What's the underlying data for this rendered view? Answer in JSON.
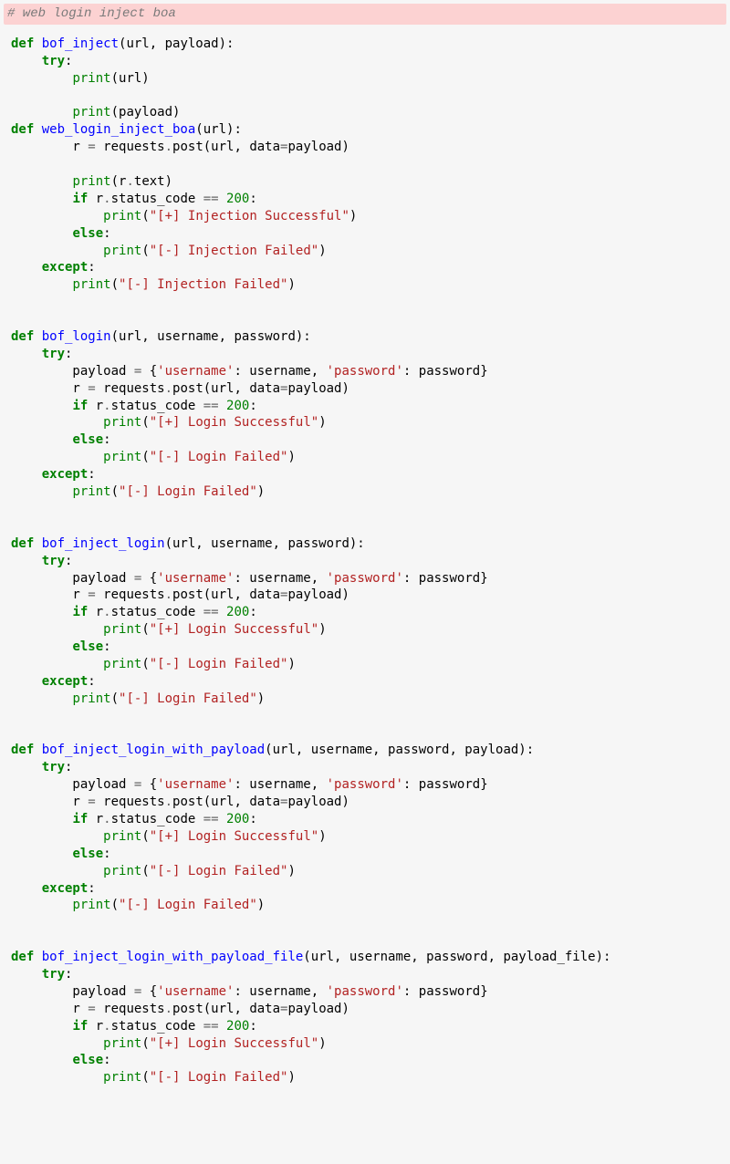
{
  "language": "python",
  "top_comment": "# web login inject boa",
  "code_lines": [
    {
      "i": 0,
      "t": "def ",
      "c": "kw"
    },
    {
      "t": "bof_inject",
      "c": "fn"
    },
    {
      "t": "(url, payload):",
      "c": ""
    },
    {
      "br": 1
    },
    {
      "i": 1,
      "t": "try",
      "c": "kw"
    },
    {
      "t": ":",
      "c": ""
    },
    {
      "br": 1
    },
    {
      "i": 2,
      "t": "print",
      "c": "bi"
    },
    {
      "t": "(url)",
      "c": ""
    },
    {
      "br": 2
    },
    {
      "i": 2,
      "t": "print",
      "c": "bi"
    },
    {
      "t": "(payload)",
      "c": ""
    },
    {
      "br": 1
    },
    {
      "i": 0,
      "t": "def ",
      "c": "kw"
    },
    {
      "t": "web_login_inject_boa",
      "c": "fn"
    },
    {
      "t": "(url):",
      "c": ""
    },
    {
      "br": 1
    },
    {
      "i": 2,
      "t": "r ",
      "c": ""
    },
    {
      "t": "=",
      "c": "op"
    },
    {
      "t": " requests",
      "c": ""
    },
    {
      "t": ".",
      "c": "op"
    },
    {
      "t": "post(url, data",
      "c": ""
    },
    {
      "t": "=",
      "c": "op"
    },
    {
      "t": "payload)",
      "c": ""
    },
    {
      "br": 2
    },
    {
      "i": 2,
      "t": "print",
      "c": "bi"
    },
    {
      "t": "(r",
      "c": ""
    },
    {
      "t": ".",
      "c": "op"
    },
    {
      "t": "text)",
      "c": ""
    },
    {
      "br": 1
    },
    {
      "i": 2,
      "t": "if",
      "c": "kw"
    },
    {
      "t": " r",
      "c": ""
    },
    {
      "t": ".",
      "c": "op"
    },
    {
      "t": "status_code ",
      "c": ""
    },
    {
      "t": "==",
      "c": "op"
    },
    {
      "t": " ",
      "c": ""
    },
    {
      "t": "200",
      "c": "num"
    },
    {
      "t": ":",
      "c": ""
    },
    {
      "br": 1
    },
    {
      "i": 3,
      "t": "print",
      "c": "bi"
    },
    {
      "t": "(",
      "c": ""
    },
    {
      "t": "\"[+] Injection Successful\"",
      "c": "str"
    },
    {
      "t": ")",
      "c": ""
    },
    {
      "br": 1
    },
    {
      "i": 2,
      "t": "else",
      "c": "kw"
    },
    {
      "t": ":",
      "c": ""
    },
    {
      "br": 1
    },
    {
      "i": 3,
      "t": "print",
      "c": "bi"
    },
    {
      "t": "(",
      "c": ""
    },
    {
      "t": "\"[-] Injection Failed\"",
      "c": "str"
    },
    {
      "t": ")",
      "c": ""
    },
    {
      "br": 1
    },
    {
      "i": 1,
      "t": "except",
      "c": "kw"
    },
    {
      "t": ":",
      "c": ""
    },
    {
      "br": 1
    },
    {
      "i": 2,
      "t": "print",
      "c": "bi"
    },
    {
      "t": "(",
      "c": ""
    },
    {
      "t": "\"[-] Injection Failed\"",
      "c": "str"
    },
    {
      "t": ")",
      "c": ""
    },
    {
      "br": 3
    },
    {
      "i": 0,
      "t": "def ",
      "c": "kw"
    },
    {
      "t": "bof_login",
      "c": "fn"
    },
    {
      "t": "(url, username, password):",
      "c": ""
    },
    {
      "br": 1
    },
    {
      "i": 1,
      "t": "try",
      "c": "kw"
    },
    {
      "t": ":",
      "c": ""
    },
    {
      "br": 1
    },
    {
      "i": 2,
      "t": "payload ",
      "c": ""
    },
    {
      "t": "=",
      "c": "op"
    },
    {
      "t": " {",
      "c": ""
    },
    {
      "t": "'username'",
      "c": "str"
    },
    {
      "t": ": username, ",
      "c": ""
    },
    {
      "t": "'password'",
      "c": "str"
    },
    {
      "t": ": password}",
      "c": ""
    },
    {
      "br": 1
    },
    {
      "i": 2,
      "t": "r ",
      "c": ""
    },
    {
      "t": "=",
      "c": "op"
    },
    {
      "t": " requests",
      "c": ""
    },
    {
      "t": ".",
      "c": "op"
    },
    {
      "t": "post(url, data",
      "c": ""
    },
    {
      "t": "=",
      "c": "op"
    },
    {
      "t": "payload)",
      "c": ""
    },
    {
      "br": 1
    },
    {
      "i": 2,
      "t": "if",
      "c": "kw"
    },
    {
      "t": " r",
      "c": ""
    },
    {
      "t": ".",
      "c": "op"
    },
    {
      "t": "status_code ",
      "c": ""
    },
    {
      "t": "==",
      "c": "op"
    },
    {
      "t": " ",
      "c": ""
    },
    {
      "t": "200",
      "c": "num"
    },
    {
      "t": ":",
      "c": ""
    },
    {
      "br": 1
    },
    {
      "i": 3,
      "t": "print",
      "c": "bi"
    },
    {
      "t": "(",
      "c": ""
    },
    {
      "t": "\"[+] Login Successful\"",
      "c": "str"
    },
    {
      "t": ")",
      "c": ""
    },
    {
      "br": 1
    },
    {
      "i": 2,
      "t": "else",
      "c": "kw"
    },
    {
      "t": ":",
      "c": ""
    },
    {
      "br": 1
    },
    {
      "i": 3,
      "t": "print",
      "c": "bi"
    },
    {
      "t": "(",
      "c": ""
    },
    {
      "t": "\"[-] Login Failed\"",
      "c": "str"
    },
    {
      "t": ")",
      "c": ""
    },
    {
      "br": 1
    },
    {
      "i": 1,
      "t": "except",
      "c": "kw"
    },
    {
      "t": ":",
      "c": ""
    },
    {
      "br": 1
    },
    {
      "i": 2,
      "t": "print",
      "c": "bi"
    },
    {
      "t": "(",
      "c": ""
    },
    {
      "t": "\"[-] Login Failed\"",
      "c": "str"
    },
    {
      "t": ")",
      "c": ""
    },
    {
      "br": 3
    },
    {
      "i": 0,
      "t": "def ",
      "c": "kw"
    },
    {
      "t": "bof_inject_login",
      "c": "fn"
    },
    {
      "t": "(url, username, password):",
      "c": ""
    },
    {
      "br": 1
    },
    {
      "i": 1,
      "t": "try",
      "c": "kw"
    },
    {
      "t": ":",
      "c": ""
    },
    {
      "br": 1
    },
    {
      "i": 2,
      "t": "payload ",
      "c": ""
    },
    {
      "t": "=",
      "c": "op"
    },
    {
      "t": " {",
      "c": ""
    },
    {
      "t": "'username'",
      "c": "str"
    },
    {
      "t": ": username, ",
      "c": ""
    },
    {
      "t": "'password'",
      "c": "str"
    },
    {
      "t": ": password}",
      "c": ""
    },
    {
      "br": 1
    },
    {
      "i": 2,
      "t": "r ",
      "c": ""
    },
    {
      "t": "=",
      "c": "op"
    },
    {
      "t": " requests",
      "c": ""
    },
    {
      "t": ".",
      "c": "op"
    },
    {
      "t": "post(url, data",
      "c": ""
    },
    {
      "t": "=",
      "c": "op"
    },
    {
      "t": "payload)",
      "c": ""
    },
    {
      "br": 1
    },
    {
      "i": 2,
      "t": "if",
      "c": "kw"
    },
    {
      "t": " r",
      "c": ""
    },
    {
      "t": ".",
      "c": "op"
    },
    {
      "t": "status_code ",
      "c": ""
    },
    {
      "t": "==",
      "c": "op"
    },
    {
      "t": " ",
      "c": ""
    },
    {
      "t": "200",
      "c": "num"
    },
    {
      "t": ":",
      "c": ""
    },
    {
      "br": 1
    },
    {
      "i": 3,
      "t": "print",
      "c": "bi"
    },
    {
      "t": "(",
      "c": ""
    },
    {
      "t": "\"[+] Login Successful\"",
      "c": "str"
    },
    {
      "t": ")",
      "c": ""
    },
    {
      "br": 1
    },
    {
      "i": 2,
      "t": "else",
      "c": "kw"
    },
    {
      "t": ":",
      "c": ""
    },
    {
      "br": 1
    },
    {
      "i": 3,
      "t": "print",
      "c": "bi"
    },
    {
      "t": "(",
      "c": ""
    },
    {
      "t": "\"[-] Login Failed\"",
      "c": "str"
    },
    {
      "t": ")",
      "c": ""
    },
    {
      "br": 1
    },
    {
      "i": 1,
      "t": "except",
      "c": "kw"
    },
    {
      "t": ":",
      "c": ""
    },
    {
      "br": 1
    },
    {
      "i": 2,
      "t": "print",
      "c": "bi"
    },
    {
      "t": "(",
      "c": ""
    },
    {
      "t": "\"[-] Login Failed\"",
      "c": "str"
    },
    {
      "t": ")",
      "c": ""
    },
    {
      "br": 3
    },
    {
      "i": 0,
      "t": "def ",
      "c": "kw"
    },
    {
      "t": "bof_inject_login_with_payload",
      "c": "fn"
    },
    {
      "t": "(url, username, password, payload):",
      "c": ""
    },
    {
      "br": 1
    },
    {
      "i": 1,
      "t": "try",
      "c": "kw"
    },
    {
      "t": ":",
      "c": ""
    },
    {
      "br": 1
    },
    {
      "i": 2,
      "t": "payload ",
      "c": ""
    },
    {
      "t": "=",
      "c": "op"
    },
    {
      "t": " {",
      "c": ""
    },
    {
      "t": "'username'",
      "c": "str"
    },
    {
      "t": ": username, ",
      "c": ""
    },
    {
      "t": "'password'",
      "c": "str"
    },
    {
      "t": ": password}",
      "c": ""
    },
    {
      "br": 1
    },
    {
      "i": 2,
      "t": "r ",
      "c": ""
    },
    {
      "t": "=",
      "c": "op"
    },
    {
      "t": " requests",
      "c": ""
    },
    {
      "t": ".",
      "c": "op"
    },
    {
      "t": "post(url, data",
      "c": ""
    },
    {
      "t": "=",
      "c": "op"
    },
    {
      "t": "payload)",
      "c": ""
    },
    {
      "br": 1
    },
    {
      "i": 2,
      "t": "if",
      "c": "kw"
    },
    {
      "t": " r",
      "c": ""
    },
    {
      "t": ".",
      "c": "op"
    },
    {
      "t": "status_code ",
      "c": ""
    },
    {
      "t": "==",
      "c": "op"
    },
    {
      "t": " ",
      "c": ""
    },
    {
      "t": "200",
      "c": "num"
    },
    {
      "t": ":",
      "c": ""
    },
    {
      "br": 1
    },
    {
      "i": 3,
      "t": "print",
      "c": "bi"
    },
    {
      "t": "(",
      "c": ""
    },
    {
      "t": "\"[+] Login Successful\"",
      "c": "str"
    },
    {
      "t": ")",
      "c": ""
    },
    {
      "br": 1
    },
    {
      "i": 2,
      "t": "else",
      "c": "kw"
    },
    {
      "t": ":",
      "c": ""
    },
    {
      "br": 1
    },
    {
      "i": 3,
      "t": "print",
      "c": "bi"
    },
    {
      "t": "(",
      "c": ""
    },
    {
      "t": "\"[-] Login Failed\"",
      "c": "str"
    },
    {
      "t": ")",
      "c": ""
    },
    {
      "br": 1
    },
    {
      "i": 1,
      "t": "except",
      "c": "kw"
    },
    {
      "t": ":",
      "c": ""
    },
    {
      "br": 1
    },
    {
      "i": 2,
      "t": "print",
      "c": "bi"
    },
    {
      "t": "(",
      "c": ""
    },
    {
      "t": "\"[-] Login Failed\"",
      "c": "str"
    },
    {
      "t": ")",
      "c": ""
    },
    {
      "br": 3
    },
    {
      "i": 0,
      "t": "def ",
      "c": "kw"
    },
    {
      "t": "bof_inject_login_with_payload_file",
      "c": "fn"
    },
    {
      "t": "(url, username, password, payload_file):",
      "c": ""
    },
    {
      "br": 1
    },
    {
      "i": 1,
      "t": "try",
      "c": "kw"
    },
    {
      "t": ":",
      "c": ""
    },
    {
      "br": 1
    },
    {
      "i": 2,
      "t": "payload ",
      "c": ""
    },
    {
      "t": "=",
      "c": "op"
    },
    {
      "t": " {",
      "c": ""
    },
    {
      "t": "'username'",
      "c": "str"
    },
    {
      "t": ": username, ",
      "c": ""
    },
    {
      "t": "'password'",
      "c": "str"
    },
    {
      "t": ": password}",
      "c": ""
    },
    {
      "br": 1
    },
    {
      "i": 2,
      "t": "r ",
      "c": ""
    },
    {
      "t": "=",
      "c": "op"
    },
    {
      "t": " requests",
      "c": ""
    },
    {
      "t": ".",
      "c": "op"
    },
    {
      "t": "post(url, data",
      "c": ""
    },
    {
      "t": "=",
      "c": "op"
    },
    {
      "t": "payload)",
      "c": ""
    },
    {
      "br": 1
    },
    {
      "i": 2,
      "t": "if",
      "c": "kw"
    },
    {
      "t": " r",
      "c": ""
    },
    {
      "t": ".",
      "c": "op"
    },
    {
      "t": "status_code ",
      "c": ""
    },
    {
      "t": "==",
      "c": "op"
    },
    {
      "t": " ",
      "c": ""
    },
    {
      "t": "200",
      "c": "num"
    },
    {
      "t": ":",
      "c": ""
    },
    {
      "br": 1
    },
    {
      "i": 3,
      "t": "print",
      "c": "bi"
    },
    {
      "t": "(",
      "c": ""
    },
    {
      "t": "\"[+] Login Successful\"",
      "c": "str"
    },
    {
      "t": ")",
      "c": ""
    },
    {
      "br": 1
    },
    {
      "i": 2,
      "t": "else",
      "c": "kw"
    },
    {
      "t": ":",
      "c": ""
    },
    {
      "br": 1
    },
    {
      "i": 3,
      "t": "print",
      "c": "bi"
    },
    {
      "t": "(",
      "c": ""
    },
    {
      "t": "\"[-] Login Failed\"",
      "c": "str"
    },
    {
      "t": ")",
      "c": ""
    },
    {
      "br": 0
    }
  ]
}
